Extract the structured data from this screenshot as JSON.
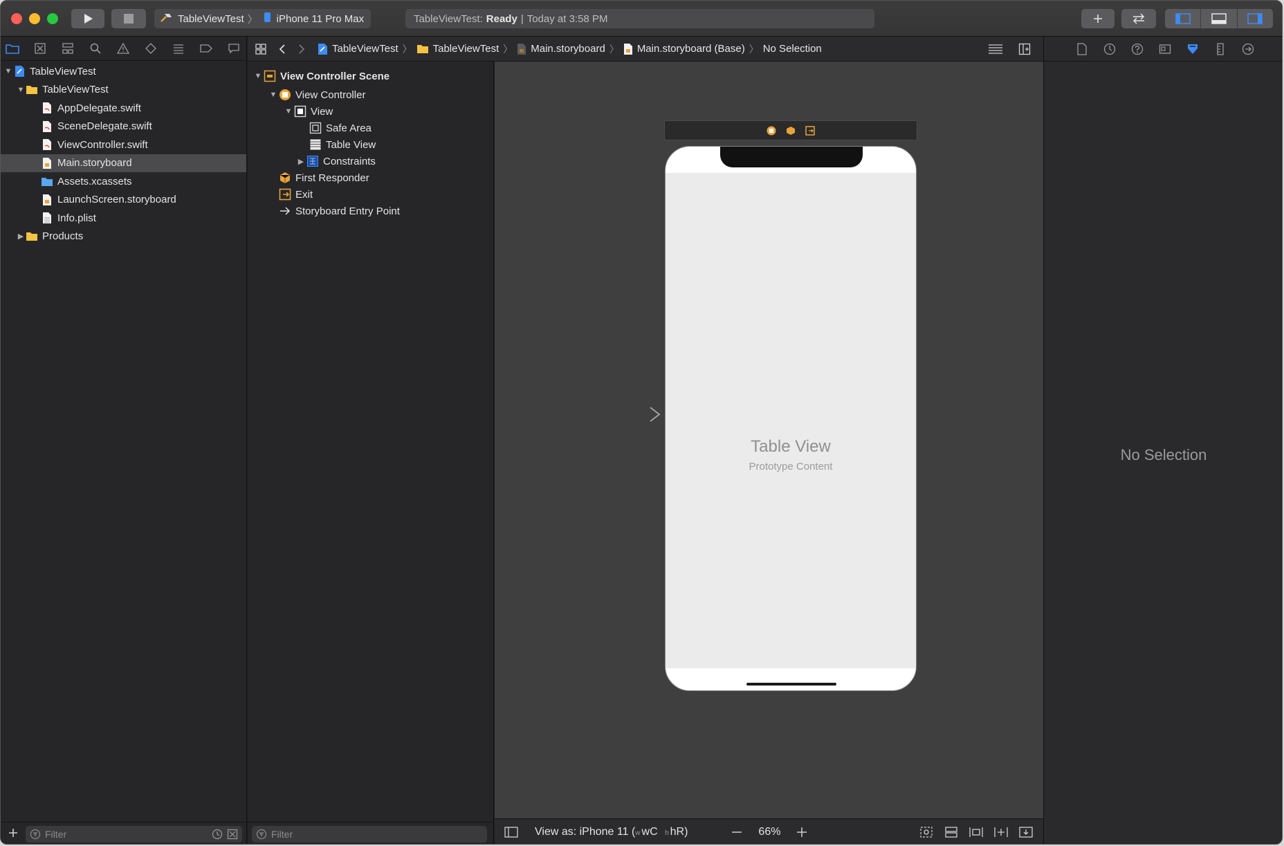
{
  "toolbar": {
    "scheme_name": "TableViewTest",
    "destination": "iPhone 11 Pro Max",
    "activity_project": "TableViewTest:",
    "activity_status": "Ready",
    "activity_time": "Today at 3:58 PM"
  },
  "navigator": {
    "items": [
      {
        "label": "TableViewTest"
      },
      {
        "label": "TableViewTest"
      },
      {
        "label": "AppDelegate.swift"
      },
      {
        "label": "SceneDelegate.swift"
      },
      {
        "label": "ViewController.swift"
      },
      {
        "label": "Main.storyboard"
      },
      {
        "label": "Assets.xcassets"
      },
      {
        "label": "LaunchScreen.storyboard"
      },
      {
        "label": "Info.plist"
      },
      {
        "label": "Products"
      }
    ],
    "filter_placeholder": "Filter"
  },
  "jumpbar": {
    "crumbs": [
      "TableViewTest",
      "TableViewTest",
      "Main.storyboard",
      "Main.storyboard (Base)",
      "No Selection"
    ]
  },
  "outline": {
    "items": [
      {
        "label": "View Controller Scene"
      },
      {
        "label": "View Controller"
      },
      {
        "label": "View"
      },
      {
        "label": "Safe Area"
      },
      {
        "label": "Table View"
      },
      {
        "label": "Constraints"
      },
      {
        "label": "First Responder"
      },
      {
        "label": "Exit"
      },
      {
        "label": "Storyboard Entry Point"
      }
    ],
    "filter_placeholder": "Filter"
  },
  "canvas": {
    "table_view_title": "Table View",
    "table_view_subtitle": "Prototype Content",
    "view_as": "View as: iPhone 11 (",
    "size_class_w": "wC",
    "size_class_h": "hR)",
    "zoom": "66%"
  },
  "inspector": {
    "no_selection": "No Selection"
  },
  "colors": {
    "accent_blue": "#3d8cf5",
    "folder_yellow": "#f5c344",
    "storyboard_orange": "#e8a33a"
  }
}
